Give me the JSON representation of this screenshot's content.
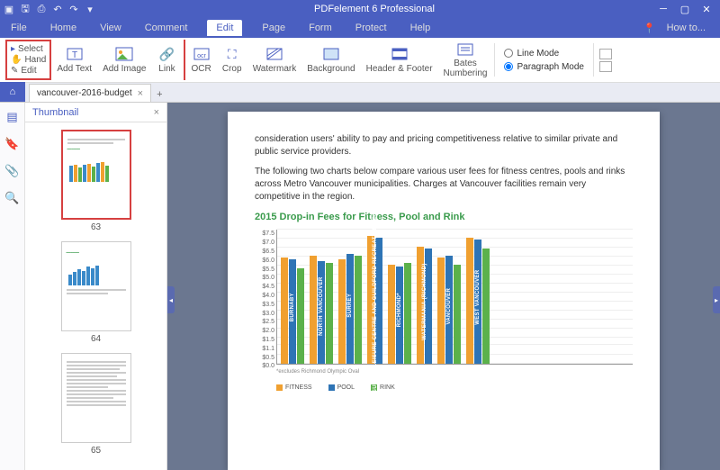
{
  "titlebar": {
    "title": "PDFelement 6 Professional"
  },
  "menu": {
    "items": [
      "File",
      "Home",
      "View",
      "Comment",
      "Edit",
      "Page",
      "Form",
      "Protect",
      "Help"
    ],
    "active": "Edit",
    "howto": "How to..."
  },
  "ribbon": {
    "selGroup": [
      {
        "icon": "▸",
        "label": "Select"
      },
      {
        "icon": "✋",
        "label": "Hand"
      },
      {
        "icon": "✎",
        "label": "Edit"
      }
    ],
    "buttons": [
      {
        "name": "add-text",
        "label": "Add Text"
      },
      {
        "name": "add-image",
        "label": "Add Image"
      },
      {
        "name": "link",
        "label": "Link"
      },
      {
        "name": "ocr",
        "label": "OCR"
      },
      {
        "name": "crop",
        "label": "Crop"
      },
      {
        "name": "watermark",
        "label": "Watermark"
      },
      {
        "name": "background",
        "label": "Background"
      },
      {
        "name": "header-footer",
        "label": "Header & Footer"
      },
      {
        "name": "bates",
        "label": "Bates\nNumbering"
      }
    ],
    "mode": {
      "line": "Line Mode",
      "para": "Paragraph Mode",
      "value": "para"
    }
  },
  "tab": {
    "name": "vancouver-2016-budget",
    "plus": "+"
  },
  "thumbnail": {
    "title": "Thumbnail",
    "pages": [
      63,
      64,
      65
    ],
    "selected": 63
  },
  "doc": {
    "p1": "consideration users' ability to pay and pricing competitiveness relative to similar private and public service providers.",
    "p2": "The following two charts below compare various user fees for fitness centres, pools and rinks across Metro Vancouver municipalities. Charges at Vancouver facilities remain very competitive in the region.",
    "chartTitle": "2015 Drop-in Fees for Fitness, Pool and Rink",
    "footnote": "*excludes Richmond Olympic Oval",
    "legend": {
      "fitness": "FITNESS",
      "pool": "POOL",
      "rink": "RINK"
    }
  },
  "chart_data": {
    "type": "bar",
    "title": "2015 Drop-in Fees for Fitness, Pool and Rink",
    "ylabel": "$",
    "ylim": [
      0,
      7.5
    ],
    "yticks": [
      7.5,
      7.0,
      6.5,
      6.0,
      5.5,
      5.0,
      4.5,
      4.0,
      3.5,
      3.0,
      2.5,
      2.0,
      1.5,
      1.1,
      0.5,
      0.0
    ],
    "categories": [
      "BURNABY",
      "NORTH VANCOUVER",
      "SURREY",
      "SURREY LEISURE CENTRE AND GUILDFORD RECREATION CENTRE",
      "RICHMOND*",
      "WATERMANIA (RICHMOND)",
      "VANCOUVER",
      "WEST VANCOUVER"
    ],
    "series": [
      {
        "name": "FITNESS",
        "color": "#f0a030",
        "values": [
          5.9,
          6.0,
          5.8,
          7.1,
          5.5,
          6.5,
          5.9,
          7.0
        ]
      },
      {
        "name": "POOL",
        "color": "#2e74b5",
        "values": [
          5.8,
          5.7,
          6.1,
          7.0,
          5.4,
          6.4,
          6.0,
          6.9
        ]
      },
      {
        "name": "RINK",
        "color": "#5bb14b",
        "values": [
          5.3,
          5.6,
          6.0,
          null,
          5.6,
          null,
          5.5,
          6.4
        ]
      }
    ]
  }
}
